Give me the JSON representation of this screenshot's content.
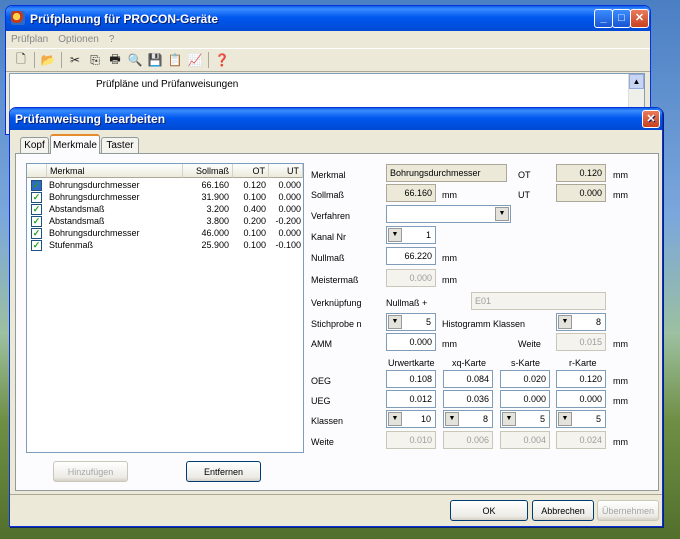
{
  "main_window": {
    "title": "Prüfplanung für PROCON-Geräte",
    "menu": [
      "Prüfplan",
      "Optionen",
      "?"
    ],
    "toolbar_icons": [
      "new-icon",
      "open-icon",
      "cut-icon",
      "copy-icon",
      "print-icon",
      "preview-icon",
      "save-icon",
      "paste-icon",
      "chart-icon",
      "help-icon"
    ],
    "toolbar_glyphs": [
      "🗋",
      "📂",
      "✂",
      "⎘",
      "🖶",
      "🔍",
      "💾",
      "📋",
      "📈",
      "❓"
    ],
    "caption": {
      "minimize": "_",
      "maximize": "□",
      "close": "✕"
    },
    "panel_label": "Prüfpläne und Prüfanweisungen",
    "scroll_up": "▲"
  },
  "dialog": {
    "title": "Prüfanweisung bearbeiten",
    "close": "✕",
    "tabs": [
      "Kopf",
      "Merkmale",
      "Taster"
    ],
    "list": {
      "columns": [
        "Merkmal",
        "Sollmaß",
        "OT",
        "UT"
      ],
      "rows": [
        {
          "name": "Bohrungsdurchmesser",
          "soll": "66.160",
          "ot": "0.120",
          "ut": "0.000",
          "check": "✓"
        },
        {
          "name": "Bohrungsdurchmesser",
          "soll": "31.900",
          "ot": "0.100",
          "ut": "0.000",
          "check": "✓"
        },
        {
          "name": "Abstandsmaß",
          "soll": "3.200",
          "ot": "0.400",
          "ut": "0.000",
          "check": "✓"
        },
        {
          "name": "Abstandsmaß",
          "soll": "3.800",
          "ot": "0.200",
          "ut": "-0.200",
          "check": "✓"
        },
        {
          "name": "Bohrungsdurchmesser",
          "soll": "46.000",
          "ot": "0.100",
          "ut": "0.000",
          "check": "✓"
        },
        {
          "name": "Stufenmaß",
          "soll": "25.900",
          "ot": "0.100",
          "ut": "-0.100",
          "check": "✓"
        }
      ]
    },
    "buttons": {
      "add": "Hinzufügen",
      "remove": "Entfernen",
      "ok": "OK",
      "cancel": "Abbrechen",
      "apply": "Übernehmen"
    },
    "form": {
      "merkmal_label": "Merkmal",
      "merkmal_value": "Bohrungsdurchmesser",
      "ot_label": "OT",
      "ot_value": "0.120",
      "ut_label": "UT",
      "ut_value": "0.000",
      "sollmass_label": "Sollmaß",
      "sollmass_value": "66.160",
      "verfahren_label": "Verfahren",
      "verfahren_value": "",
      "kanal_label": "Kanal Nr",
      "kanal_value": "1",
      "nullmass_label": "Nullmaß",
      "nullmass_value": "66.220",
      "meistermass_label": "Meistermaß",
      "meistermass_value": "0.000",
      "verknuepfung_label": "Verknüpfung",
      "verknuepfung_prefix": "Nullmaß +",
      "verknuepfung_value": "E01",
      "stichprobe_label": "Stichprobe n",
      "stichprobe_value": "5",
      "histogramm_label": "Histogramm Klassen",
      "histogramm_value": "8",
      "amm_label": "AMM",
      "amm_value": "0.000",
      "weite_label": "Weite",
      "weite_value": "0.015",
      "unit": "mm",
      "spin_glyph": "▼",
      "card_columns": [
        "Urwertkarte",
        "xq-Karte",
        "s-Karte",
        "r-Karte"
      ],
      "oeg_label": "OEG",
      "oeg_values": [
        "0.108",
        "0.084",
        "0.020",
        "0.120"
      ],
      "ueg_label": "UEG",
      "ueg_values": [
        "0.012",
        "0.036",
        "0.000",
        "0.000"
      ],
      "klassen_label": "Klassen",
      "klassen_values": [
        "10",
        "8",
        "5",
        "5"
      ],
      "weite_row_label": "Weite",
      "weite_row_values": [
        "0.010",
        "0.006",
        "0.004",
        "0.024"
      ]
    }
  }
}
